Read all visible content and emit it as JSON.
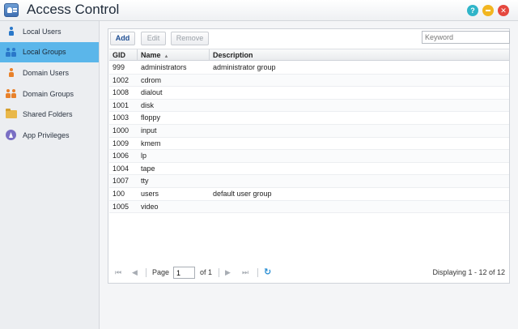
{
  "window": {
    "title": "Access Control",
    "help_symbol": "?",
    "colors": {
      "accent": "#5bb6ea",
      "help": "#2fb5c9",
      "minimize": "#f2b621",
      "close": "#e5483f"
    }
  },
  "sidebar": {
    "items": [
      {
        "label": "Local Users",
        "icon": "user-icon",
        "color": "#2a78c9"
      },
      {
        "label": "Local Groups",
        "icon": "group-icon",
        "color": "#2a78c9"
      },
      {
        "label": "Domain Users",
        "icon": "domain-user-icon",
        "color": "#e8812a"
      },
      {
        "label": "Domain Groups",
        "icon": "domain-group-icon",
        "color": "#e8812a"
      },
      {
        "label": "Shared Folders",
        "icon": "folder-icon",
        "color": "#e9b84a"
      },
      {
        "label": "App Privileges",
        "icon": "app-privileges-icon",
        "color": "#7a6fc4"
      }
    ],
    "active_index": 1
  },
  "toolbar": {
    "add_label": "Add",
    "edit_label": "Edit",
    "remove_label": "Remove",
    "search_placeholder": "Keyword"
  },
  "table": {
    "columns": {
      "gid": "GID",
      "name": "Name",
      "description": "Description"
    },
    "rows": [
      {
        "gid": "999",
        "name": "administrators",
        "description": "administrator group"
      },
      {
        "gid": "1002",
        "name": "cdrom",
        "description": ""
      },
      {
        "gid": "1008",
        "name": "dialout",
        "description": ""
      },
      {
        "gid": "1001",
        "name": "disk",
        "description": ""
      },
      {
        "gid": "1003",
        "name": "floppy",
        "description": ""
      },
      {
        "gid": "1000",
        "name": "input",
        "description": ""
      },
      {
        "gid": "1009",
        "name": "kmem",
        "description": ""
      },
      {
        "gid": "1006",
        "name": "lp",
        "description": ""
      },
      {
        "gid": "1004",
        "name": "tape",
        "description": ""
      },
      {
        "gid": "1007",
        "name": "tty",
        "description": ""
      },
      {
        "gid": "100",
        "name": "users",
        "description": "default user group"
      },
      {
        "gid": "1005",
        "name": "video",
        "description": ""
      }
    ]
  },
  "pager": {
    "page_label": "Page",
    "page_value": "1",
    "of_label": "of 1",
    "display_text": "Displaying 1 - 12 of 12"
  }
}
